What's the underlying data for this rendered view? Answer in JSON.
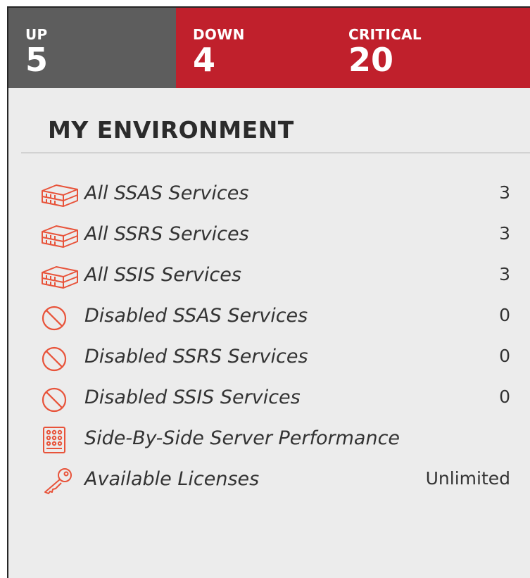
{
  "status": {
    "up": {
      "label": "UP",
      "count": "5"
    },
    "down": {
      "label": "DOWN",
      "count": "4"
    },
    "critical": {
      "label": "CRITICAL",
      "count": "20"
    }
  },
  "environment": {
    "title": "MY ENVIRONMENT",
    "items": [
      {
        "icon": "server-icon",
        "label": "All SSAS Services",
        "value": "3"
      },
      {
        "icon": "server-icon",
        "label": "All SSRS Services",
        "value": "3"
      },
      {
        "icon": "server-icon",
        "label": "All SSIS Services",
        "value": "3"
      },
      {
        "icon": "disabled-icon",
        "label": "Disabled SSAS Services",
        "value": "0"
      },
      {
        "icon": "disabled-icon",
        "label": "Disabled SSRS Services",
        "value": "0"
      },
      {
        "icon": "disabled-icon",
        "label": "Disabled SSIS Services",
        "value": "0"
      },
      {
        "icon": "grid-icon",
        "label": "Side-By-Side Server Performance",
        "value": ""
      },
      {
        "icon": "key-icon",
        "label": "Available Licenses",
        "value": "Unlimited"
      }
    ]
  },
  "colors": {
    "accent": "#e8533a",
    "critical": "#c0202c",
    "up": "#5d5d5d"
  }
}
